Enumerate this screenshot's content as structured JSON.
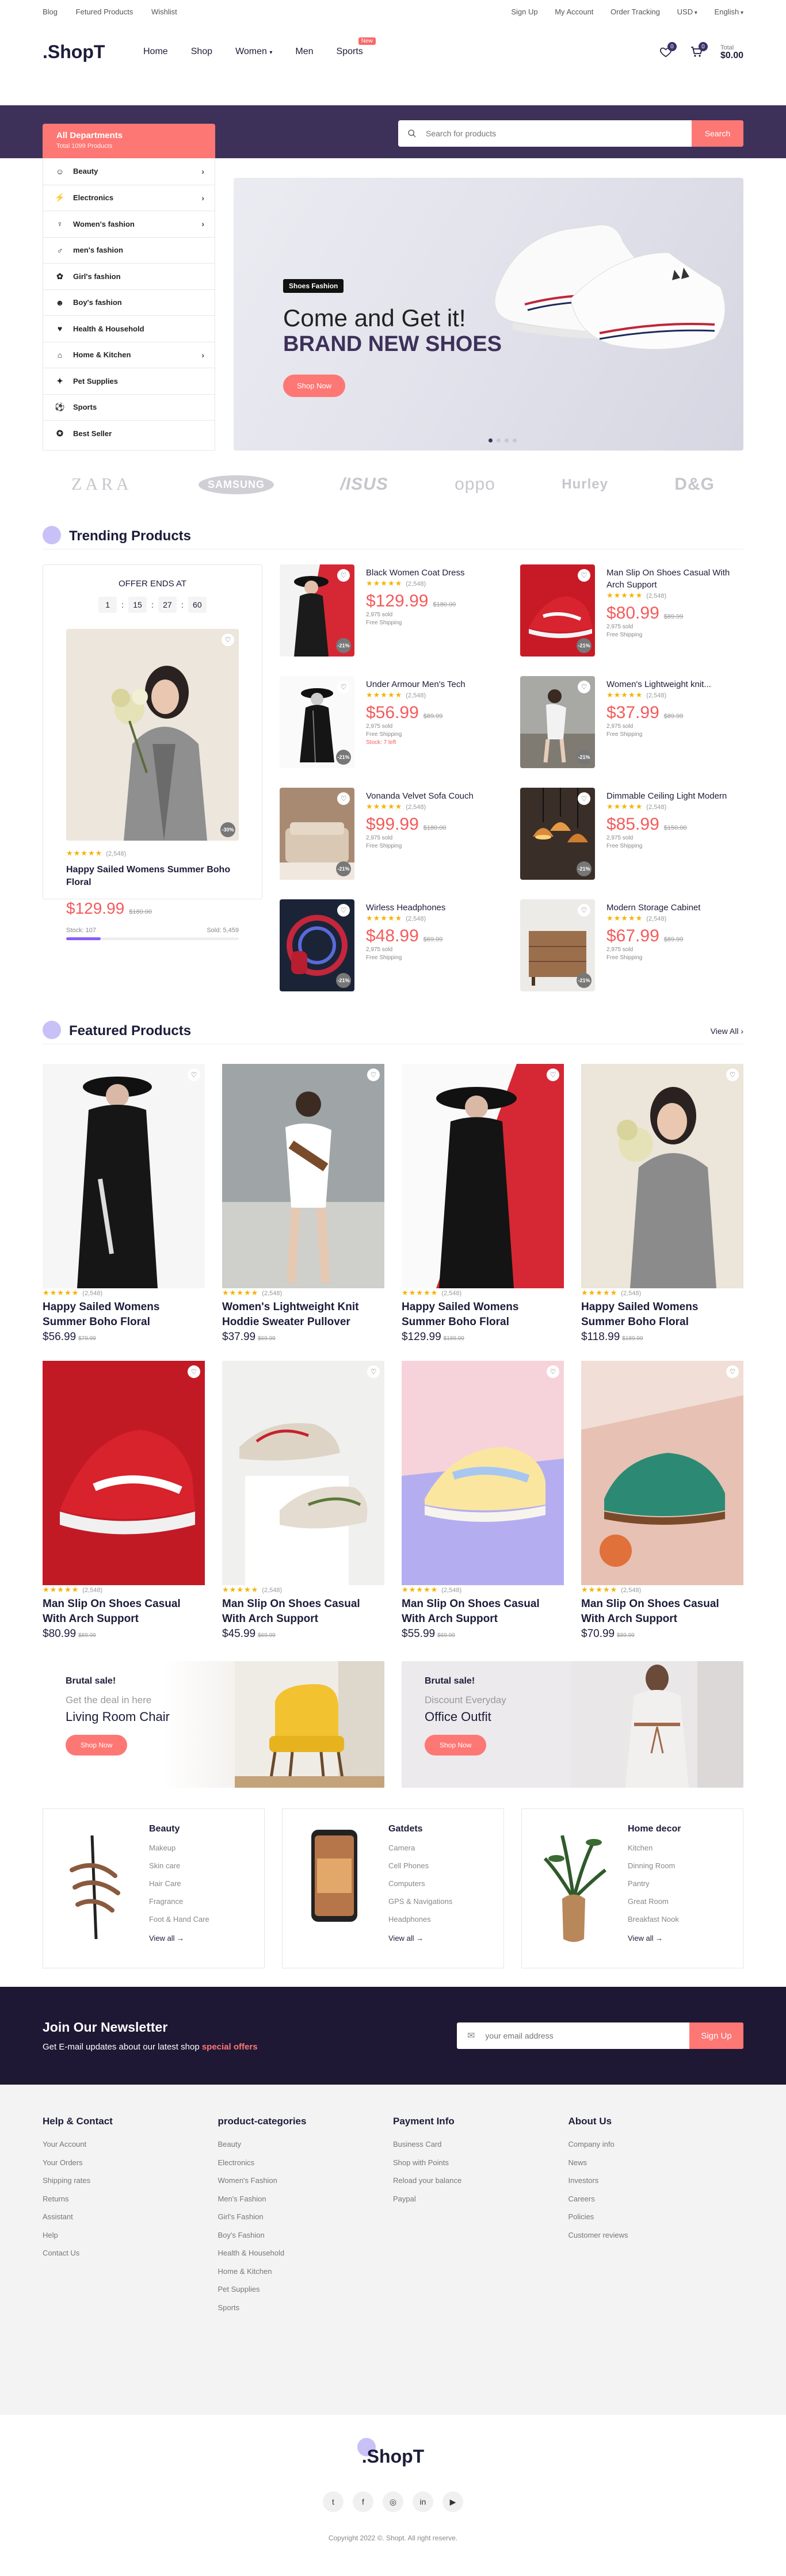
{
  "topbar": {
    "links": [
      "Blog",
      "Fetured Products",
      "Wishlist"
    ],
    "right": [
      "Sign Up",
      "My Account",
      "Order Tracking",
      "USD",
      "English"
    ]
  },
  "header": {
    "logo": ".ShopT",
    "nav": [
      "Home",
      "Shop",
      "Women",
      "Men",
      "Sports"
    ],
    "nav_badge": "New",
    "wishlist_count": "0",
    "cart_count": "0",
    "total_label": "Total",
    "total_value": "$0.00"
  },
  "departments": {
    "title": "All Departments",
    "subtitle": "Total 1099 Products",
    "items": [
      "Beauty",
      "Electronics",
      "Women's fashion",
      "men's fashion",
      "Girl's fashion",
      "Boy's fashion",
      "Health & Household",
      "Home & Kitchen",
      "Pet Supplies",
      "Sports",
      "Best Seller"
    ],
    "arrow": [
      true,
      true,
      true,
      false,
      false,
      false,
      false,
      true,
      false,
      false,
      false
    ]
  },
  "search": {
    "placeholder": "Search for products",
    "button": "Search"
  },
  "hero": {
    "tag": "Shoes Fashion",
    "line1": "Come and Get it!",
    "line2": "BRAND NEW SHOES",
    "button": "Shop Now",
    "slides": 4,
    "active": 0
  },
  "brands": [
    "ZARA",
    "SAMSUNG",
    "/ISUS",
    "oppo",
    "Hurley",
    "D&G"
  ],
  "trending": {
    "title": "Trending Products",
    "offer": {
      "label": "OFFER ENDS AT",
      "timer": [
        "1",
        "15",
        "27",
        "60"
      ],
      "reviews": "(2,548)",
      "name": "Happy Sailed Womens Summer Boho Floral",
      "price": "$129.99",
      "old": "$180.00",
      "stock": "Stock: 107",
      "sold": "Sold: 5,459",
      "sold_fraction": 0.2,
      "badge": "-30%"
    },
    "items": [
      {
        "name": "Black Women Coat Dress",
        "price": "$129.99",
        "old": "$180.00",
        "reviews": "(2,548)",
        "sold": "2,975 sold",
        "ship": "Free Shipping",
        "extra": "",
        "badge": "-21%"
      },
      {
        "name": "Man Slip On Shoes Casual With Arch Support",
        "price": "$80.99",
        "old": "$89.99",
        "reviews": "(2,548)",
        "sold": "2,975 sold",
        "ship": "Free Shipping",
        "extra": "",
        "badge": "-21%"
      },
      {
        "name": "Under Armour Men's Tech",
        "price": "$56.99",
        "old": "$89.99",
        "reviews": "(2,548)",
        "sold": "2,975 sold",
        "ship": "Free Shipping",
        "extra": "Stock: 7 left",
        "badge": "-21%"
      },
      {
        "name": "Women's Lightweight knit...",
        "price": "$37.99",
        "old": "$89.99",
        "reviews": "(2,548)",
        "sold": "2,975 sold",
        "ship": "Free Shipping",
        "extra": "",
        "badge": "-21%"
      },
      {
        "name": "Vonanda Velvet Sofa Couch",
        "price": "$99.99",
        "old": "$180.00",
        "reviews": "(2,548)",
        "sold": "2,975 sold",
        "ship": "Free Shipping",
        "extra": "",
        "badge": "-21%"
      },
      {
        "name": "Dimmable Ceiling Light Modern",
        "price": "$85.99",
        "old": "$150.00",
        "reviews": "(2,548)",
        "sold": "2,975 sold",
        "ship": "Free Shipping",
        "extra": "",
        "badge": "-21%"
      },
      {
        "name": "Wirless Headphones",
        "price": "$48.99",
        "old": "$69.99",
        "reviews": "(2,548)",
        "sold": "2,975 sold",
        "ship": "Free Shipping",
        "extra": "",
        "badge": "-21%"
      },
      {
        "name": "Modern Storage Cabinet",
        "price": "$67.99",
        "old": "$89.99",
        "reviews": "(2,548)",
        "sold": "2,975 sold",
        "ship": "Free Shipping",
        "extra": "",
        "badge": "-21%"
      }
    ]
  },
  "featured": {
    "title": "Featured Products",
    "view_all": "View All",
    "items": [
      {
        "name": "Happy Sailed Womens Summer Boho Floral",
        "price": "$56.99",
        "old": "$79.99",
        "reviews": "(2,548)"
      },
      {
        "name": "Women's Lightweight Knit Hoddie Sweater Pullover",
        "price": "$37.99",
        "old": "$69.99",
        "reviews": "(2,548)"
      },
      {
        "name": "Happy Sailed Womens Summer Boho Floral",
        "price": "$129.99",
        "old": "$189.99",
        "reviews": "(2,548)"
      },
      {
        "name": "Happy Sailed Womens Summer Boho Floral",
        "price": "$118.99",
        "old": "$189.99",
        "reviews": "(2,548)"
      },
      {
        "name": "Man Slip On Shoes Casual With Arch Support",
        "price": "$80.99",
        "old": "$89.99",
        "reviews": "(2,548)"
      },
      {
        "name": "Man Slip On Shoes Casual With Arch Support",
        "price": "$45.99",
        "old": "$69.99",
        "reviews": "(2,548)"
      },
      {
        "name": "Man Slip On Shoes Casual With Arch Support",
        "price": "$55.99",
        "old": "$69.99",
        "reviews": "(2,548)"
      },
      {
        "name": "Man Slip On Shoes Casual With Arch Support",
        "price": "$70.99",
        "old": "$89.99",
        "reviews": "(2,548)"
      }
    ]
  },
  "promos": [
    {
      "title": "Brutal sale!",
      "sub": "Get the deal in here",
      "line": "Living Room Chair",
      "button": "Shop Now"
    },
    {
      "title": "Brutal sale!",
      "sub": "Discount Everyday",
      "line": "Office Outfit",
      "button": "Shop Now"
    }
  ],
  "catboxes": [
    {
      "title": "Beauty",
      "items": [
        "Makeup",
        "Skin care",
        "Hair Care",
        "Fragrance",
        "Foot & Hand Care"
      ],
      "view": "View all"
    },
    {
      "title": "Gatdets",
      "items": [
        "Camera",
        "Cell Phones",
        "Computers",
        "GPS & Navigations",
        "Headphones"
      ],
      "view": "View all"
    },
    {
      "title": "Home decor",
      "items": [
        "Kitchen",
        "Dinning Room",
        "Pantry",
        "Great Room",
        "Breakfast Nook"
      ],
      "view": "View all"
    }
  ],
  "newsletter": {
    "title": "Join Our Newsletter",
    "text": "Get E-mail updates about our latest shop ",
    "highlight": "special offers",
    "placeholder": "your email address",
    "button": "Sign Up"
  },
  "footer": {
    "cols": [
      {
        "title": "Help & Contact",
        "items": [
          "Your Account",
          "Your Orders",
          "Shipping rates",
          "Returns",
          "Assistant",
          "Help",
          "Contact Us"
        ]
      },
      {
        "title": "product-categories",
        "items": [
          "Beauty",
          "Electronics",
          "Women's Fashion",
          "Men's Fashion",
          "Girl's Fashion",
          "Boy's Fashion",
          "Health & Household",
          "Home & Kitchen",
          "Pet Supplies",
          "Sports"
        ]
      },
      {
        "title": "Payment Info",
        "items": [
          "Business Card",
          "Shop with Points",
          "Reload your balance",
          "Paypal"
        ]
      },
      {
        "title": "About Us",
        "items": [
          "Company info",
          "News",
          "Investors",
          "Careers",
          "Policies",
          "Customer reviews"
        ]
      }
    ],
    "logo": ".ShopT",
    "copyright": "Copyright 2022 ©. Shopt. All right reserve."
  },
  "colors": {
    "accent": "#fd7774",
    "dark": "#3d3159",
    "price": "#f45b5b",
    "purple_dot": "#c7c1f7"
  }
}
